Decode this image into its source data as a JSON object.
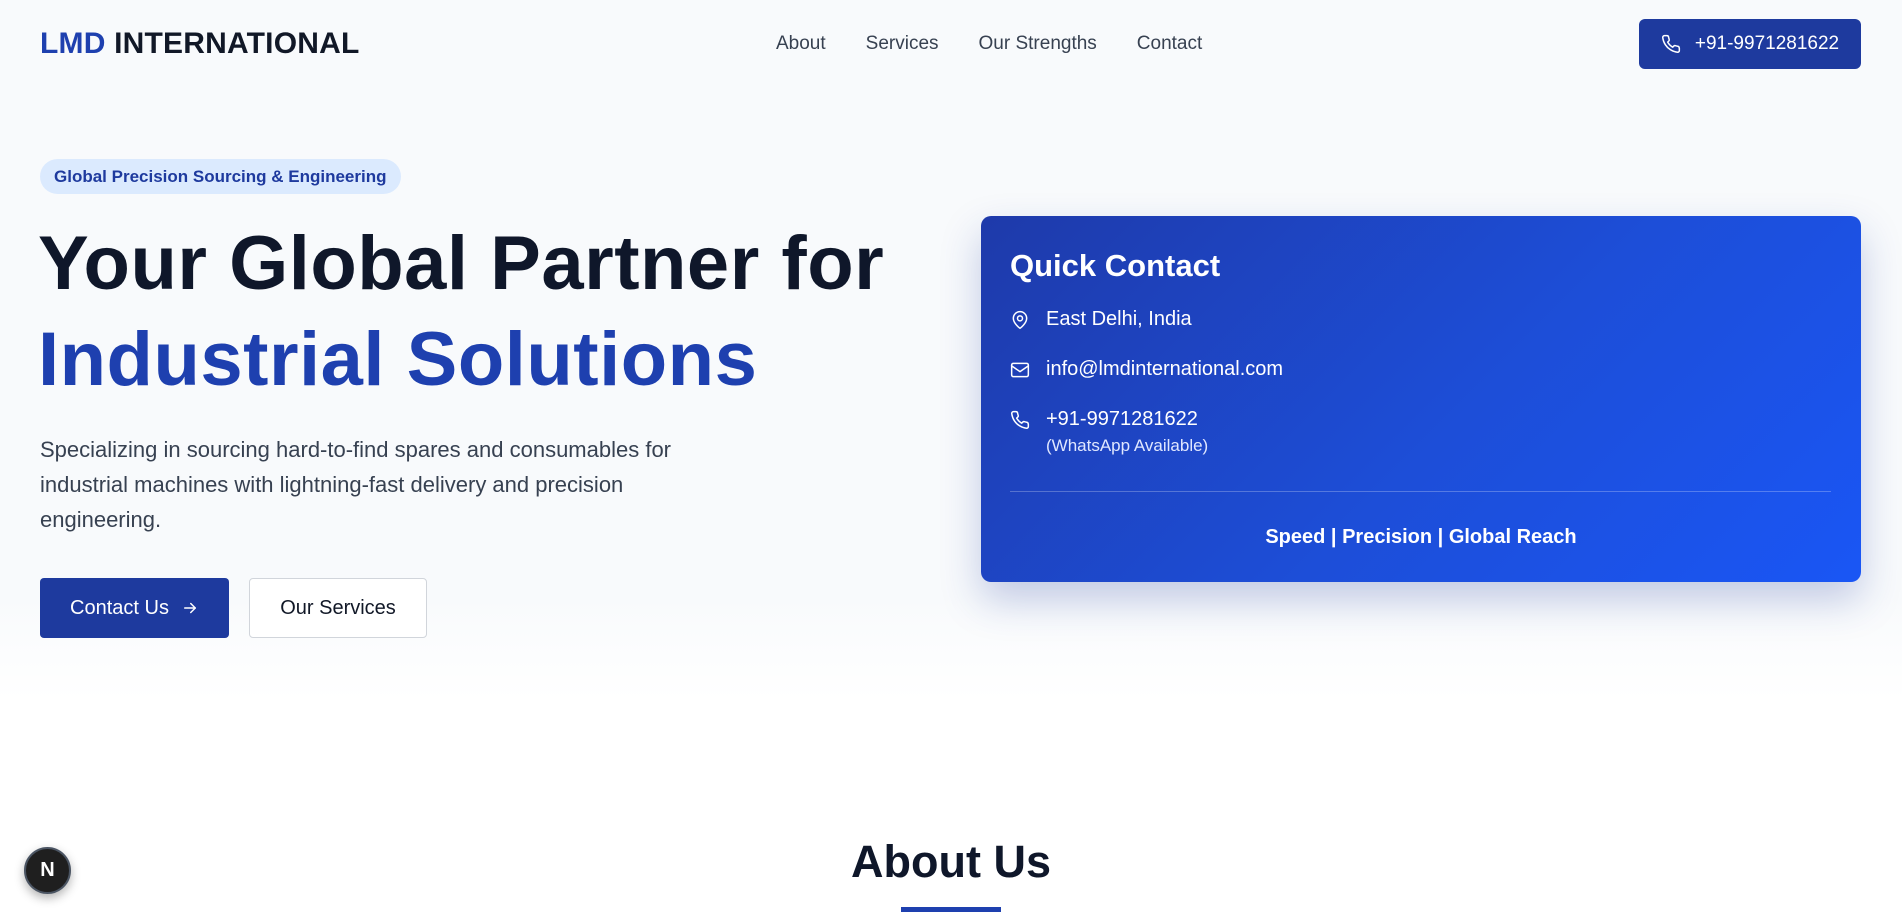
{
  "header": {
    "logo_accent": "LMD",
    "logo_rest": " INTERNATIONAL",
    "nav": [
      "About",
      "Services",
      "Our Strengths",
      "Contact"
    ],
    "phone_label": "+91-9971281622"
  },
  "hero": {
    "badge": "Global Precision Sourcing & Engineering",
    "headline_line1": "Your Global Partner for",
    "headline_line2": "Industrial Solutions",
    "description": "Specializing in sourcing hard-to-find spares and consumables for industrial machines with lightning-fast delivery and precision engineering.",
    "primary_button": "Contact Us",
    "secondary_button": "Our Services"
  },
  "quick_contact": {
    "title": "Quick Contact",
    "location": "East Delhi, India",
    "email": "info@lmdinternational.com",
    "phone": "+91-9971281622",
    "phone_note": "(WhatsApp Available)",
    "tagline": "Speed | Precision | Global Reach"
  },
  "about": {
    "title": "About Us"
  },
  "floating_badge": "N",
  "colors": {
    "brand": "#1e40af",
    "brand_dark": "#1e3a9e",
    "badge_bg": "#dbeafe",
    "text_dark": "#0f172a"
  },
  "icons": [
    "phone-icon",
    "map-pin-icon",
    "mail-icon",
    "arrow-right-icon"
  ]
}
